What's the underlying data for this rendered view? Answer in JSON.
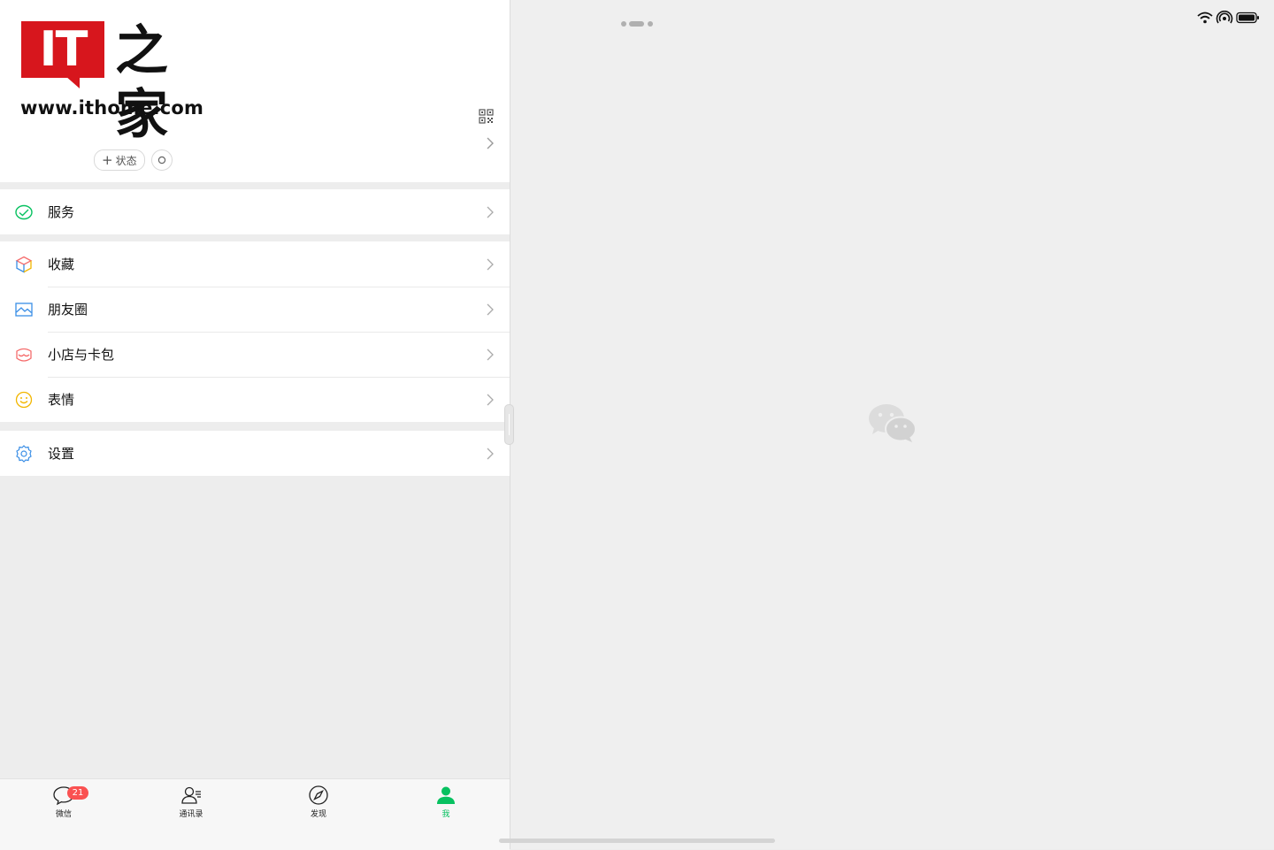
{
  "logo": {
    "it_text": "IT",
    "zhijia_text": "之家",
    "url_text": "www.ithome.com"
  },
  "profile": {
    "status_chip_label": "状态",
    "status_chip_plus": "+"
  },
  "menu": {
    "services": {
      "label": "服务",
      "icon": "services-icon"
    },
    "favorites": {
      "label": "收藏",
      "icon": "favorites-cube-icon"
    },
    "moments": {
      "label": "朋友圈",
      "icon": "moments-picture-icon"
    },
    "shop_cards": {
      "label": "小店与卡包",
      "icon": "wallet-shop-icon"
    },
    "stickers": {
      "label": "表情",
      "icon": "smiley-icon"
    },
    "settings": {
      "label": "设置",
      "icon": "gear-icon"
    }
  },
  "tabbar": {
    "chats": {
      "label": "微信",
      "badge": "21"
    },
    "contacts": {
      "label": "通讯录"
    },
    "discover": {
      "label": "发现"
    },
    "me": {
      "label": "我",
      "active": true
    }
  },
  "colors": {
    "wechat_green": "#07c160",
    "badge_red": "#fa5151",
    "it_red": "#d7161d"
  }
}
